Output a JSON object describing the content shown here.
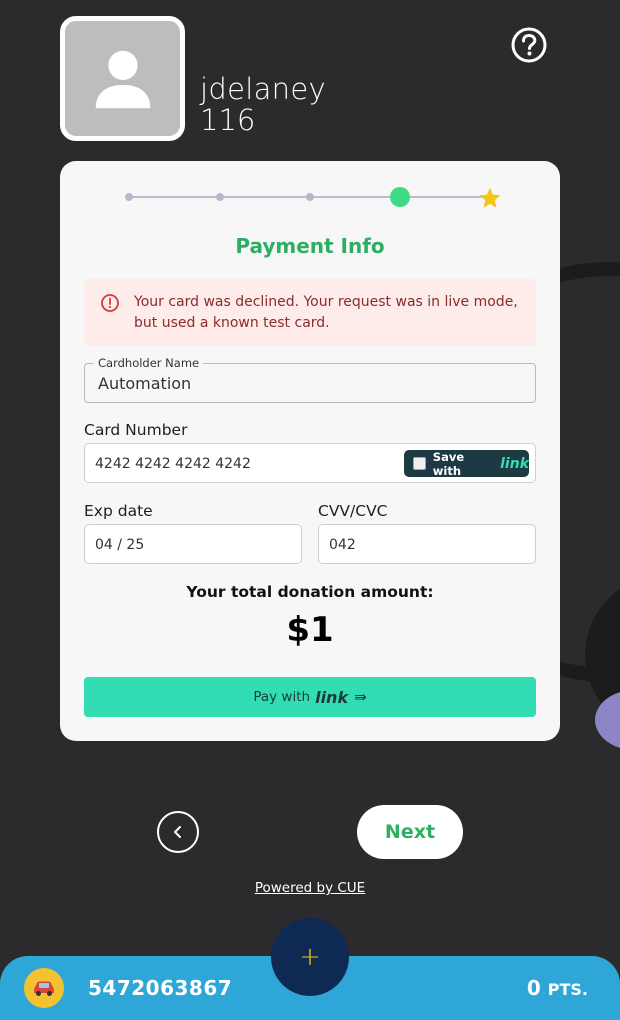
{
  "header": {
    "username": "jdelaney",
    "points_display": "116",
    "help_icon": "help-circle-icon",
    "avatar_icon": "person-icon"
  },
  "stepper": {
    "total_steps": 5,
    "current_step": 4,
    "final_icon": "star-icon"
  },
  "card": {
    "title": "Payment Info",
    "alert": {
      "icon": "error-circle-icon",
      "message": "Your card was declined. Your request was in live mode, but used a known test card."
    },
    "cardholder": {
      "legend": "Cardholder Name",
      "value": "Automation"
    },
    "card_number": {
      "label": "Card Number",
      "value": "4242 4242 4242 4242",
      "save_label": "Save with",
      "save_brand": "link"
    },
    "exp": {
      "label": "Exp date",
      "value": "04 / 25"
    },
    "cvv": {
      "label": "CVV/CVC",
      "value": "042"
    },
    "total_label": "Your total donation amount:",
    "total_amount": "$1",
    "pay_button": {
      "label": "Pay with",
      "brand": "link",
      "arrow": "⇛"
    }
  },
  "nav": {
    "back_icon": "chevron-left-icon",
    "next_label": "Next",
    "powered_by": "Powered by CUE"
  },
  "bottom_bar": {
    "avatar_icon": "car-icon",
    "phone": "5472063867",
    "points": "0",
    "points_unit": "PTS.",
    "fab_label": "+"
  },
  "colors": {
    "background": "#2b2a2d",
    "accent_green": "#2eae63",
    "link_teal": "#33ddb3",
    "bottom_bar": "#2ea6d8",
    "fab": "#0e2a53",
    "star": "#f5c518"
  }
}
